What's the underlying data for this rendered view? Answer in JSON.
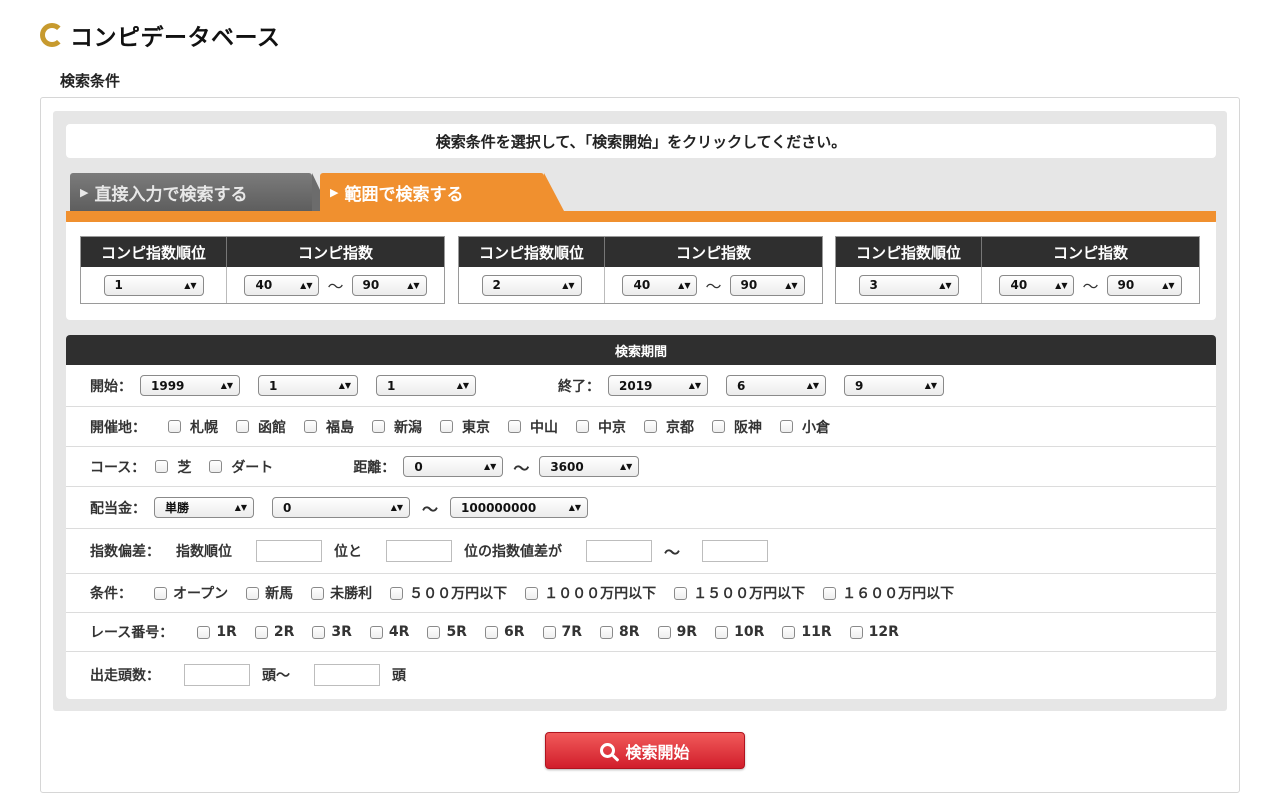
{
  "page": {
    "title": "コンピデータベース",
    "section_label": "検索条件"
  },
  "instruction": "検索条件を選択して、「検索開始」をクリックしてください。",
  "tabs": [
    {
      "label": "直接入力で検索する",
      "active": false
    },
    {
      "label": "範囲で検索する",
      "active": true
    }
  ],
  "index_tables": [
    {
      "rank_header": "コンピ指数順位",
      "index_header": "コンピ指数",
      "rank": "1",
      "min": "40",
      "max": "90"
    },
    {
      "rank_header": "コンピ指数順位",
      "index_header": "コンピ指数",
      "rank": "2",
      "min": "40",
      "max": "90"
    },
    {
      "rank_header": "コンピ指数順位",
      "index_header": "コンピ指数",
      "rank": "3",
      "min": "40",
      "max": "90"
    }
  ],
  "tilde": "〜",
  "period": {
    "header": "検索期間",
    "start_label": "開始：",
    "start": {
      "year": "1999",
      "month": "1",
      "day": "1"
    },
    "end_label": "終了：",
    "end": {
      "year": "2019",
      "month": "6",
      "day": "9"
    }
  },
  "venue": {
    "label": "開催地：",
    "options": [
      "札幌",
      "函館",
      "福島",
      "新潟",
      "東京",
      "中山",
      "中京",
      "京都",
      "阪神",
      "小倉"
    ]
  },
  "course": {
    "label": "コース：",
    "options": [
      "芝",
      "ダート"
    ],
    "distance_label": "距離：",
    "distance_min": "0",
    "distance_max": "3600"
  },
  "payout": {
    "label": "配当金：",
    "type": "単勝",
    "min": "0",
    "max": "100000000"
  },
  "deviation": {
    "label": "指数偏差：",
    "rank_label": "指数順位",
    "and_label": "位と",
    "diff_label": "位の指数値差が"
  },
  "condition": {
    "label": "条件：",
    "options": [
      "オープン",
      "新馬",
      "未勝利",
      "５００万円以下",
      "１０００万円以下",
      "１５００万円以下",
      "１６００万円以下"
    ]
  },
  "race_number": {
    "label": "レース番号：",
    "options": [
      "1R",
      "2R",
      "3R",
      "4R",
      "5R",
      "6R",
      "7R",
      "8R",
      "9R",
      "10R",
      "11R",
      "12R"
    ]
  },
  "runners": {
    "label": "出走頭数：",
    "mid_label": "頭〜",
    "end_label": "頭"
  },
  "search_button": "検索開始",
  "colors": {
    "accent_orange": "#f0902f",
    "header_dark": "#2f2f2f",
    "button_red": "#d11e2b",
    "logo_gold": "#c79a2e"
  }
}
